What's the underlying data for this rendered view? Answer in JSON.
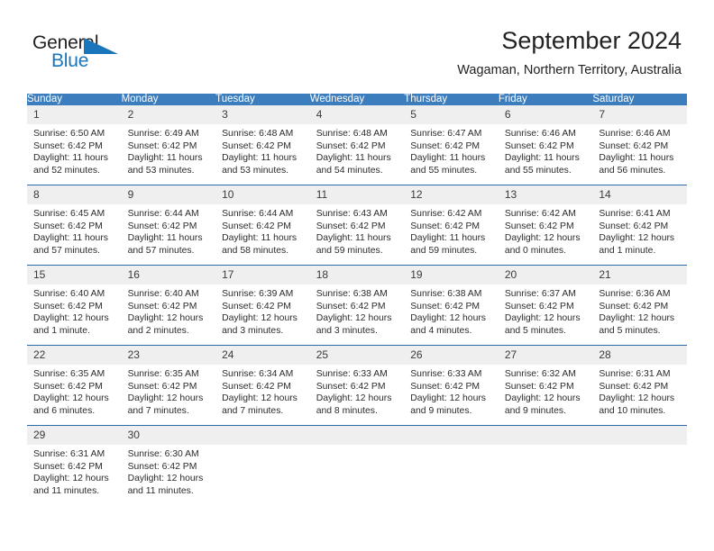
{
  "brand": {
    "name_part1": "General",
    "name_part2": "Blue",
    "accent_color": "#1b75bb",
    "logo_icon": "triangle-flag-icon"
  },
  "header": {
    "title": "September 2024",
    "subtitle": "Wagaman, Northern Territory, Australia"
  },
  "calendar": {
    "header_bg": "#3b7dbd",
    "daynum_bg": "#efefef",
    "rule_color": "#2d6ca8",
    "weekday_headers": [
      "Sunday",
      "Monday",
      "Tuesday",
      "Wednesday",
      "Thursday",
      "Friday",
      "Saturday"
    ],
    "weeks": [
      [
        {
          "day": "1",
          "sunrise": "Sunrise: 6:50 AM",
          "sunset": "Sunset: 6:42 PM",
          "daylight_line1": "Daylight: 11 hours",
          "daylight_line2": "and 52 minutes."
        },
        {
          "day": "2",
          "sunrise": "Sunrise: 6:49 AM",
          "sunset": "Sunset: 6:42 PM",
          "daylight_line1": "Daylight: 11 hours",
          "daylight_line2": "and 53 minutes."
        },
        {
          "day": "3",
          "sunrise": "Sunrise: 6:48 AM",
          "sunset": "Sunset: 6:42 PM",
          "daylight_line1": "Daylight: 11 hours",
          "daylight_line2": "and 53 minutes."
        },
        {
          "day": "4",
          "sunrise": "Sunrise: 6:48 AM",
          "sunset": "Sunset: 6:42 PM",
          "daylight_line1": "Daylight: 11 hours",
          "daylight_line2": "and 54 minutes."
        },
        {
          "day": "5",
          "sunrise": "Sunrise: 6:47 AM",
          "sunset": "Sunset: 6:42 PM",
          "daylight_line1": "Daylight: 11 hours",
          "daylight_line2": "and 55 minutes."
        },
        {
          "day": "6",
          "sunrise": "Sunrise: 6:46 AM",
          "sunset": "Sunset: 6:42 PM",
          "daylight_line1": "Daylight: 11 hours",
          "daylight_line2": "and 55 minutes."
        },
        {
          "day": "7",
          "sunrise": "Sunrise: 6:46 AM",
          "sunset": "Sunset: 6:42 PM",
          "daylight_line1": "Daylight: 11 hours",
          "daylight_line2": "and 56 minutes."
        }
      ],
      [
        {
          "day": "8",
          "sunrise": "Sunrise: 6:45 AM",
          "sunset": "Sunset: 6:42 PM",
          "daylight_line1": "Daylight: 11 hours",
          "daylight_line2": "and 57 minutes."
        },
        {
          "day": "9",
          "sunrise": "Sunrise: 6:44 AM",
          "sunset": "Sunset: 6:42 PM",
          "daylight_line1": "Daylight: 11 hours",
          "daylight_line2": "and 57 minutes."
        },
        {
          "day": "10",
          "sunrise": "Sunrise: 6:44 AM",
          "sunset": "Sunset: 6:42 PM",
          "daylight_line1": "Daylight: 11 hours",
          "daylight_line2": "and 58 minutes."
        },
        {
          "day": "11",
          "sunrise": "Sunrise: 6:43 AM",
          "sunset": "Sunset: 6:42 PM",
          "daylight_line1": "Daylight: 11 hours",
          "daylight_line2": "and 59 minutes."
        },
        {
          "day": "12",
          "sunrise": "Sunrise: 6:42 AM",
          "sunset": "Sunset: 6:42 PM",
          "daylight_line1": "Daylight: 11 hours",
          "daylight_line2": "and 59 minutes."
        },
        {
          "day": "13",
          "sunrise": "Sunrise: 6:42 AM",
          "sunset": "Sunset: 6:42 PM",
          "daylight_line1": "Daylight: 12 hours",
          "daylight_line2": "and 0 minutes."
        },
        {
          "day": "14",
          "sunrise": "Sunrise: 6:41 AM",
          "sunset": "Sunset: 6:42 PM",
          "daylight_line1": "Daylight: 12 hours",
          "daylight_line2": "and 1 minute."
        }
      ],
      [
        {
          "day": "15",
          "sunrise": "Sunrise: 6:40 AM",
          "sunset": "Sunset: 6:42 PM",
          "daylight_line1": "Daylight: 12 hours",
          "daylight_line2": "and 1 minute."
        },
        {
          "day": "16",
          "sunrise": "Sunrise: 6:40 AM",
          "sunset": "Sunset: 6:42 PM",
          "daylight_line1": "Daylight: 12 hours",
          "daylight_line2": "and 2 minutes."
        },
        {
          "day": "17",
          "sunrise": "Sunrise: 6:39 AM",
          "sunset": "Sunset: 6:42 PM",
          "daylight_line1": "Daylight: 12 hours",
          "daylight_line2": "and 3 minutes."
        },
        {
          "day": "18",
          "sunrise": "Sunrise: 6:38 AM",
          "sunset": "Sunset: 6:42 PM",
          "daylight_line1": "Daylight: 12 hours",
          "daylight_line2": "and 3 minutes."
        },
        {
          "day": "19",
          "sunrise": "Sunrise: 6:38 AM",
          "sunset": "Sunset: 6:42 PM",
          "daylight_line1": "Daylight: 12 hours",
          "daylight_line2": "and 4 minutes."
        },
        {
          "day": "20",
          "sunrise": "Sunrise: 6:37 AM",
          "sunset": "Sunset: 6:42 PM",
          "daylight_line1": "Daylight: 12 hours",
          "daylight_line2": "and 5 minutes."
        },
        {
          "day": "21",
          "sunrise": "Sunrise: 6:36 AM",
          "sunset": "Sunset: 6:42 PM",
          "daylight_line1": "Daylight: 12 hours",
          "daylight_line2": "and 5 minutes."
        }
      ],
      [
        {
          "day": "22",
          "sunrise": "Sunrise: 6:35 AM",
          "sunset": "Sunset: 6:42 PM",
          "daylight_line1": "Daylight: 12 hours",
          "daylight_line2": "and 6 minutes."
        },
        {
          "day": "23",
          "sunrise": "Sunrise: 6:35 AM",
          "sunset": "Sunset: 6:42 PM",
          "daylight_line1": "Daylight: 12 hours",
          "daylight_line2": "and 7 minutes."
        },
        {
          "day": "24",
          "sunrise": "Sunrise: 6:34 AM",
          "sunset": "Sunset: 6:42 PM",
          "daylight_line1": "Daylight: 12 hours",
          "daylight_line2": "and 7 minutes."
        },
        {
          "day": "25",
          "sunrise": "Sunrise: 6:33 AM",
          "sunset": "Sunset: 6:42 PM",
          "daylight_line1": "Daylight: 12 hours",
          "daylight_line2": "and 8 minutes."
        },
        {
          "day": "26",
          "sunrise": "Sunrise: 6:33 AM",
          "sunset": "Sunset: 6:42 PM",
          "daylight_line1": "Daylight: 12 hours",
          "daylight_line2": "and 9 minutes."
        },
        {
          "day": "27",
          "sunrise": "Sunrise: 6:32 AM",
          "sunset": "Sunset: 6:42 PM",
          "daylight_line1": "Daylight: 12 hours",
          "daylight_line2": "and 9 minutes."
        },
        {
          "day": "28",
          "sunrise": "Sunrise: 6:31 AM",
          "sunset": "Sunset: 6:42 PM",
          "daylight_line1": "Daylight: 12 hours",
          "daylight_line2": "and 10 minutes."
        }
      ],
      [
        {
          "day": "29",
          "sunrise": "Sunrise: 6:31 AM",
          "sunset": "Sunset: 6:42 PM",
          "daylight_line1": "Daylight: 12 hours",
          "daylight_line2": "and 11 minutes."
        },
        {
          "day": "30",
          "sunrise": "Sunrise: 6:30 AM",
          "sunset": "Sunset: 6:42 PM",
          "daylight_line1": "Daylight: 12 hours",
          "daylight_line2": "and 11 minutes."
        },
        {
          "day": "",
          "sunrise": "",
          "sunset": "",
          "daylight_line1": "",
          "daylight_line2": ""
        },
        {
          "day": "",
          "sunrise": "",
          "sunset": "",
          "daylight_line1": "",
          "daylight_line2": ""
        },
        {
          "day": "",
          "sunrise": "",
          "sunset": "",
          "daylight_line1": "",
          "daylight_line2": ""
        },
        {
          "day": "",
          "sunrise": "",
          "sunset": "",
          "daylight_line1": "",
          "daylight_line2": ""
        },
        {
          "day": "",
          "sunrise": "",
          "sunset": "",
          "daylight_line1": "",
          "daylight_line2": ""
        }
      ]
    ]
  }
}
